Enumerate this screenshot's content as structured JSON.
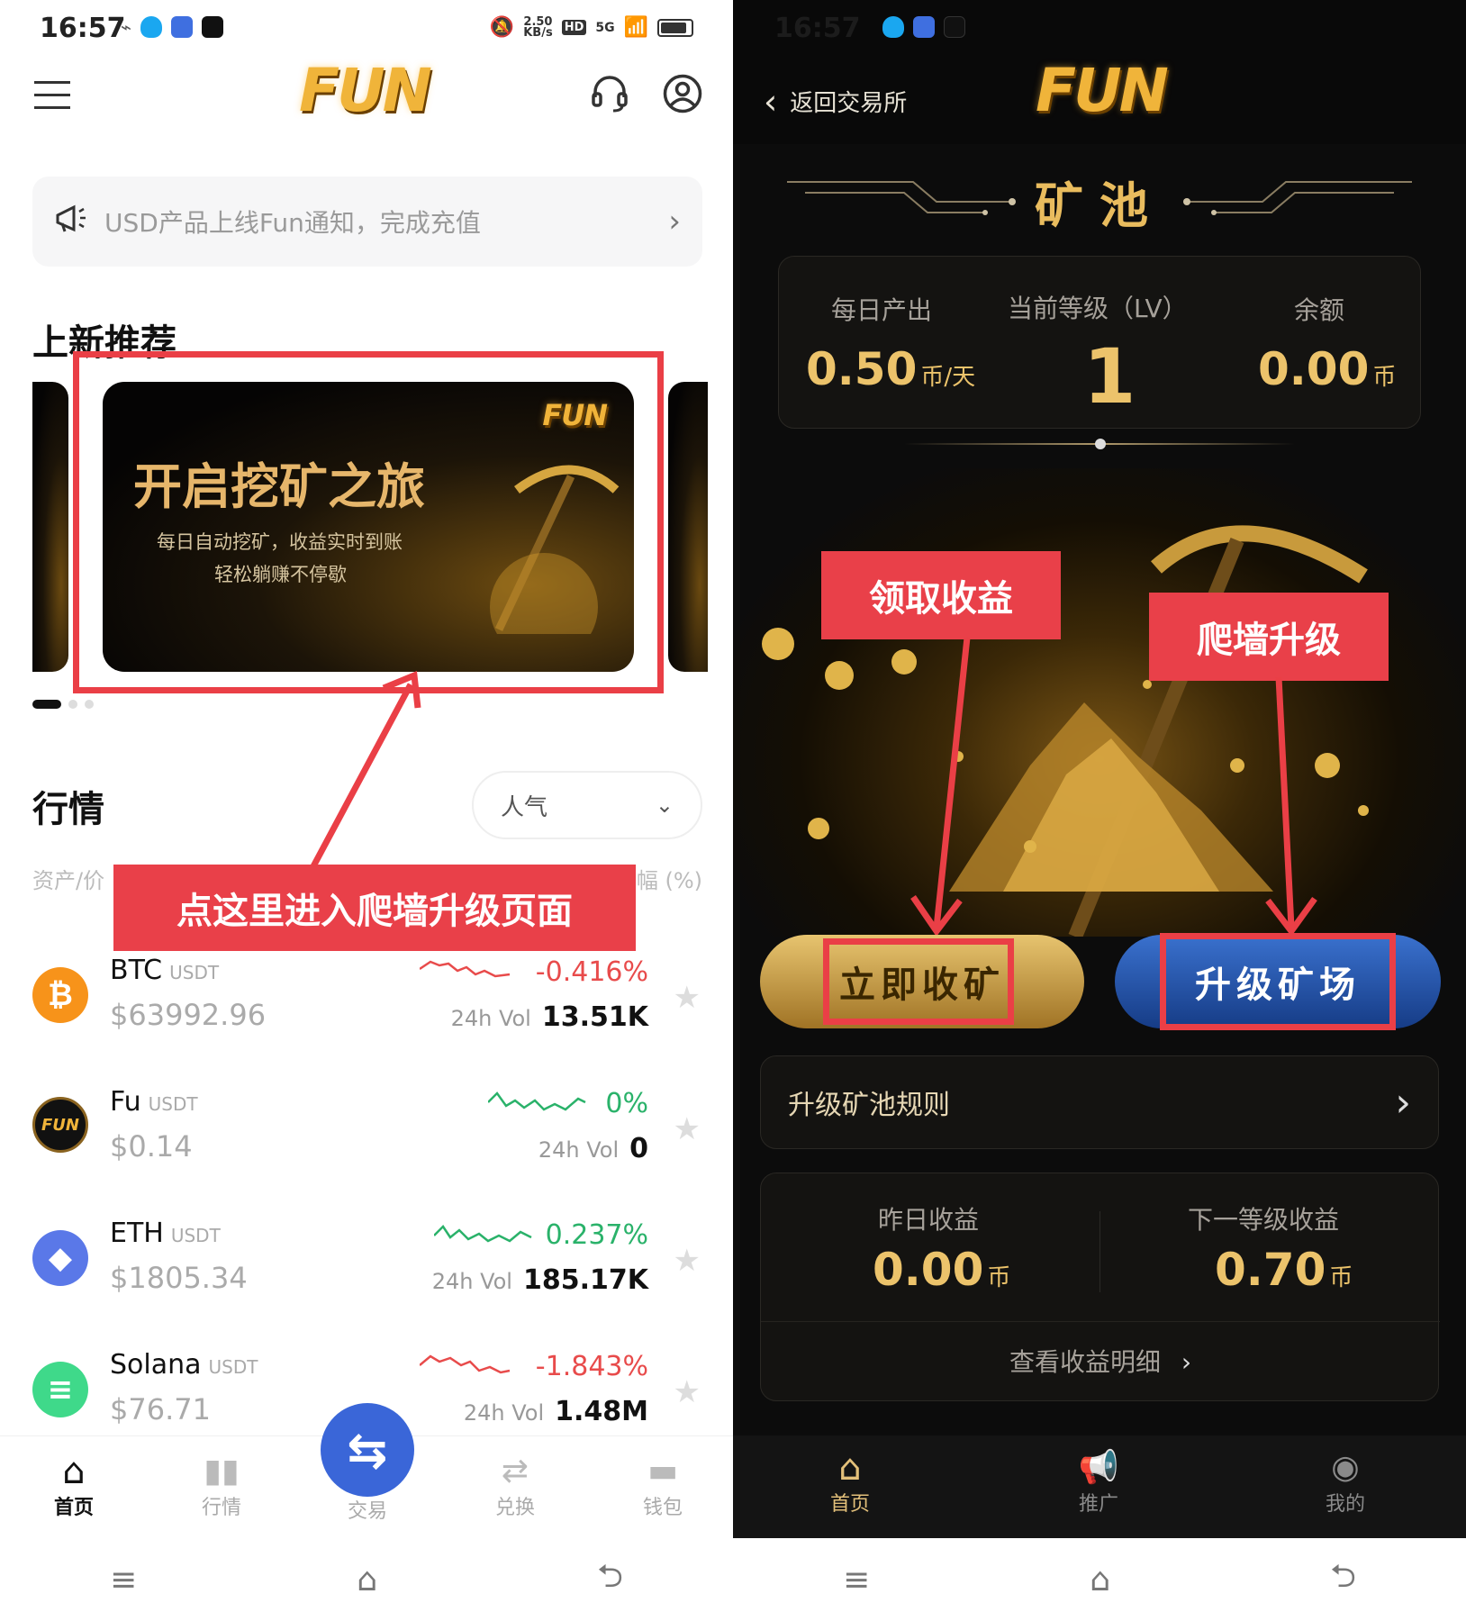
{
  "left": {
    "status": {
      "time": "16:57",
      "speed": "2.50",
      "speed_unit": "KB/s",
      "hd": "HD",
      "net": "5G"
    },
    "logo": "FUN",
    "notice": "USD产品上线Fun通知，完成充值",
    "new_title": "上新推荐",
    "banner": {
      "brand": "FUN",
      "title": "开启挖矿之旅",
      "line1": "每日自动挖矿，收益实时到账",
      "line2": "轻松躺赚不停歇"
    },
    "annotation": "点这里进入爬墙升级页面",
    "market": {
      "title": "行情",
      "sort": "人气",
      "col_left": "资产/价",
      "col_right": "幅 (%)",
      "vol_label": "24h Vol",
      "rows": [
        {
          "name": "BTC",
          "quote": "USDT",
          "price": "$63992.96",
          "change": "-0.416%",
          "vol": "13.51K"
        },
        {
          "name": "Fu",
          "quote": "USDT",
          "price": "$0.14",
          "change": "0%",
          "vol": "0"
        },
        {
          "name": "ETH",
          "quote": "USDT",
          "price": "$1805.34",
          "change": "0.237%",
          "vol": "185.17K"
        },
        {
          "name": "Solana",
          "quote": "USDT",
          "price": "$76.71",
          "change": "-1.843%",
          "vol": "1.48M"
        }
      ]
    },
    "tabs": [
      "首页",
      "行情",
      "交易",
      "兑换",
      "钱包"
    ]
  },
  "right": {
    "status": {
      "time": "16:57"
    },
    "back": "返回交易所",
    "logo": "FUN",
    "title": "矿池",
    "stats": {
      "daily_label": "每日产出",
      "daily_value": "0.50",
      "daily_unit": "币/天",
      "level_label": "当前等级（LV）",
      "level_value": "1",
      "balance_label": "余额",
      "balance_value": "0.00",
      "balance_unit": "币"
    },
    "annot_left": "领取收益",
    "annot_right": "爬墙升级",
    "btn_mine": "立即收矿",
    "btn_upgrade": "升级矿场",
    "rules": "升级矿池规则",
    "income": {
      "yesterday_label": "昨日收益",
      "yesterday_value": "0.00",
      "yesterday_unit": "币",
      "next_label": "下一等级收益",
      "next_value": "0.70",
      "next_unit": "币",
      "detail": "查看收益明细"
    },
    "tabs": [
      "首页",
      "推广",
      "我的"
    ]
  },
  "colors": {
    "red": "#ea3f46",
    "gold": "#ecc36b",
    "blue": "#3a66d8",
    "up": "#2ab26a",
    "down": "#e84b4b"
  }
}
